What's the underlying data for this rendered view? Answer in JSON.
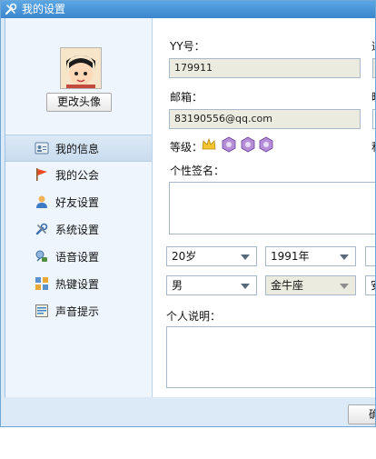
{
  "window": {
    "title": "我的设置"
  },
  "profile": {
    "change_avatar_label": "更改头像"
  },
  "sidebar": {
    "items": [
      {
        "label": "我的信息",
        "icon": "id-card-icon"
      },
      {
        "label": "我的公会",
        "icon": "flag-icon"
      },
      {
        "label": "好友设置",
        "icon": "user-icon"
      },
      {
        "label": "系统设置",
        "icon": "tools-icon"
      },
      {
        "label": "语音设置",
        "icon": "voice-icon"
      },
      {
        "label": "热键设置",
        "icon": "hotkey-icon"
      },
      {
        "label": "声音提示",
        "icon": "sound-prompt-icon"
      }
    ]
  },
  "form": {
    "yy_label": "YY号：",
    "yy_value": "179911",
    "email_label": "邮箱：",
    "email_value": "83190556@qq.com",
    "level_label": "等级：",
    "signature_label": "个性签名：",
    "age_value": "20岁",
    "birth_year_value": "1991年",
    "gender_value": "男",
    "zodiac_value": "金牛座",
    "right_col_label_1": "通",
    "right_col_label_2": "昵",
    "right_col_label_3": "积",
    "right_col_select_2": "安",
    "description_label": "个人说明："
  },
  "footer": {
    "confirm_label": "确"
  },
  "colors": {
    "accent": "#3c86cd",
    "sidebar_bg": "#eef5fc",
    "readonly_bg": "#ecebdf"
  }
}
